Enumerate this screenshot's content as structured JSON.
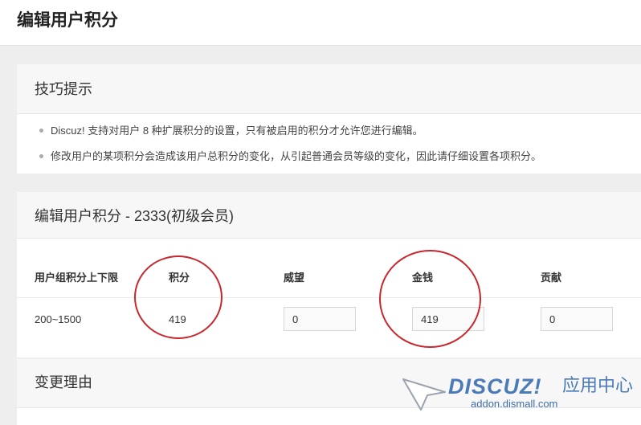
{
  "page": {
    "title": "编辑用户积分"
  },
  "tips": {
    "title": "技巧提示",
    "items": [
      "Discuz! 支持对用户 8 种扩展积分的设置，只有被启用的积分才允许您进行编辑。",
      "修改用户的某项积分会造成该用户总积分的变化，从引起普通会员等级的变化，因此请仔细设置各项积分。"
    ]
  },
  "edit": {
    "title": "编辑用户积分 - 2333(初级会员)",
    "columns": [
      "用户组积分上下限",
      "积分",
      "威望",
      "金钱",
      "贡献"
    ],
    "row": {
      "range": "200~1500",
      "credits": "419",
      "prestige": "0",
      "money": "419",
      "contribution": "0"
    },
    "highlight_color": "#c8282d"
  },
  "reason": {
    "title": "变更理由"
  },
  "watermark": {
    "logo": "DISCUZ!",
    "cn": "应用中心",
    "url": "addon.dismall.com"
  }
}
